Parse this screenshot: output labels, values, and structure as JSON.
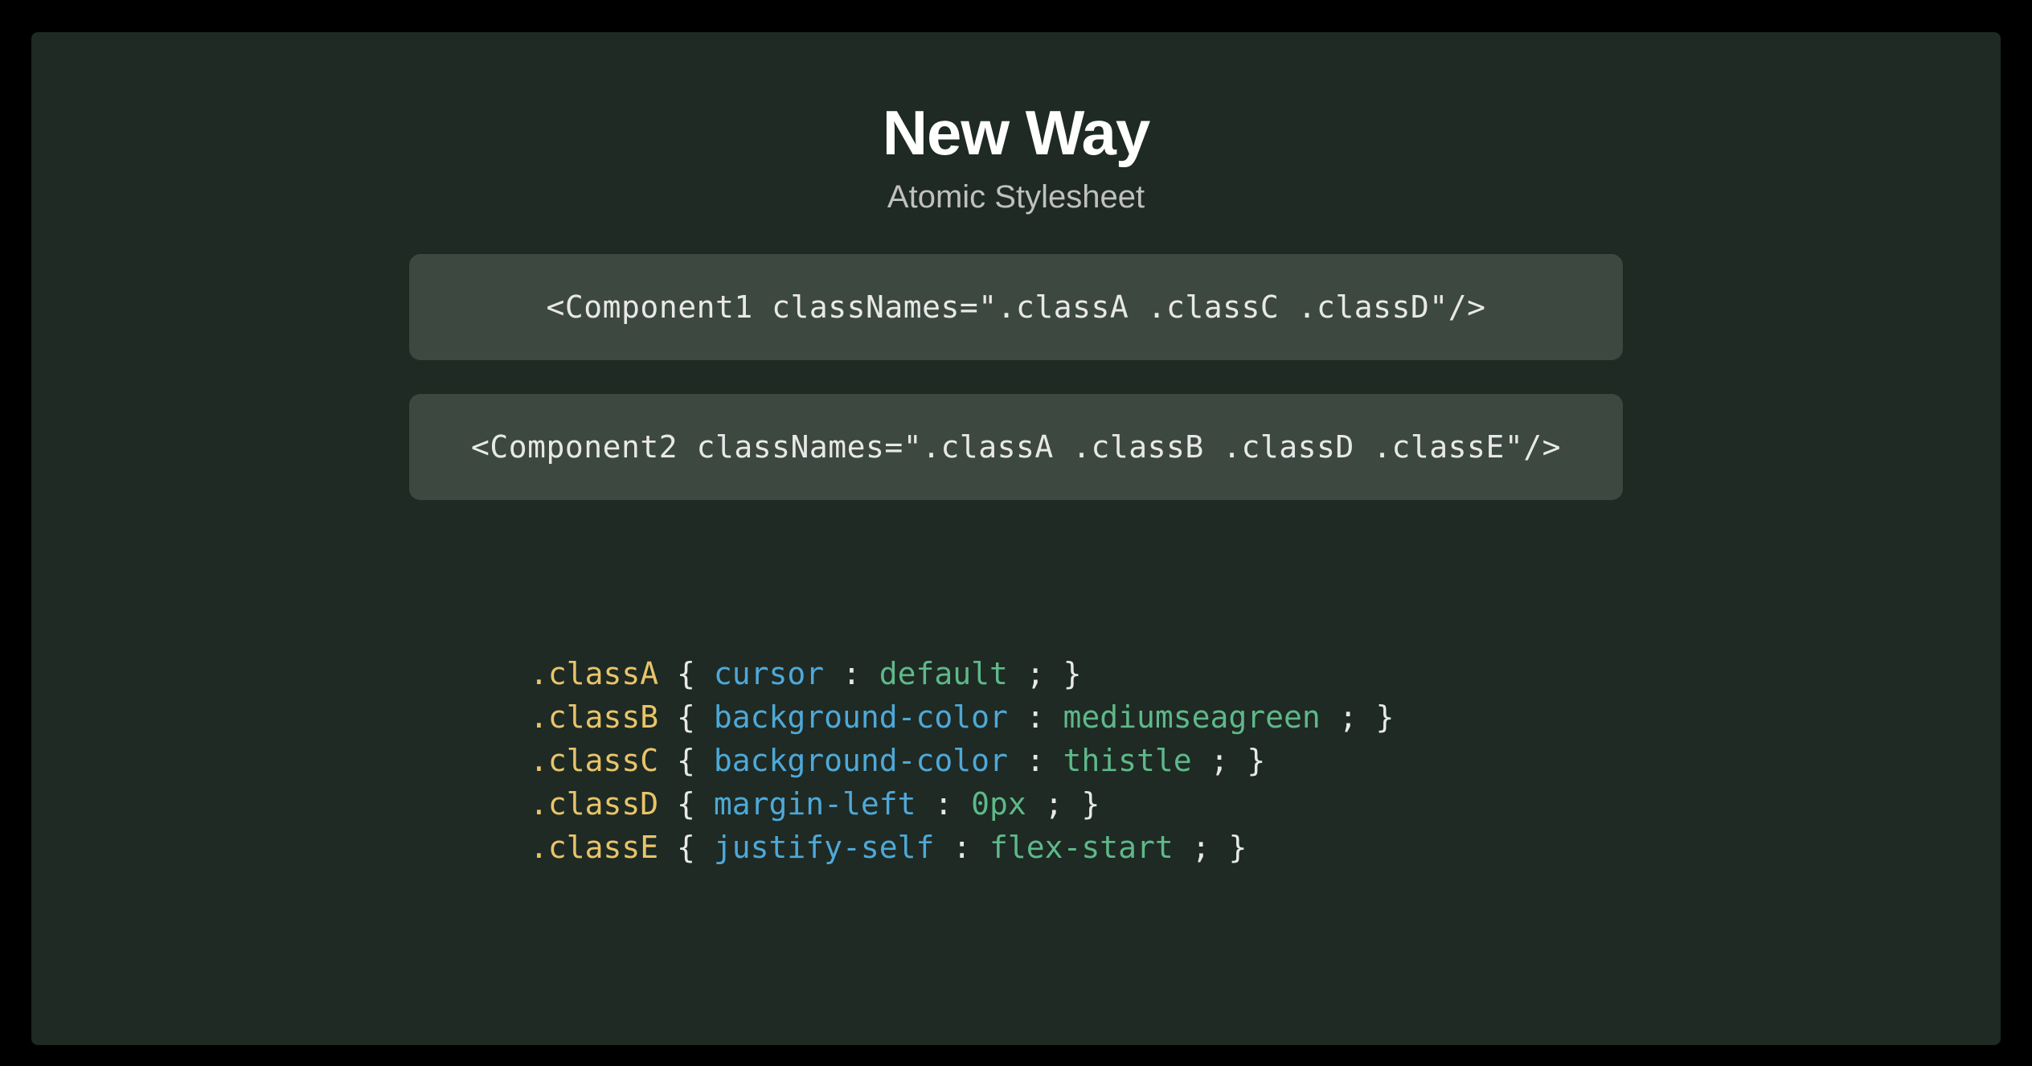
{
  "heading": {
    "title": "New Way",
    "subtitle": "Atomic Stylesheet"
  },
  "component_snippets": [
    "<Component1 classNames=\".classA .classC .classD\"/>",
    "<Component2 classNames=\".classA .classB .classD .classE\"/>"
  ],
  "css_rules": [
    {
      "selector": ".classA",
      "property": "cursor",
      "value": "default"
    },
    {
      "selector": ".classB",
      "property": "background-color",
      "value": "mediumseagreen"
    },
    {
      "selector": ".classC",
      "property": "background-color",
      "value": "thistle"
    },
    {
      "selector": ".classD",
      "property": "margin-left",
      "value": "0px"
    },
    {
      "selector": ".classE",
      "property": "justify-self",
      "value": "flex-start"
    }
  ]
}
